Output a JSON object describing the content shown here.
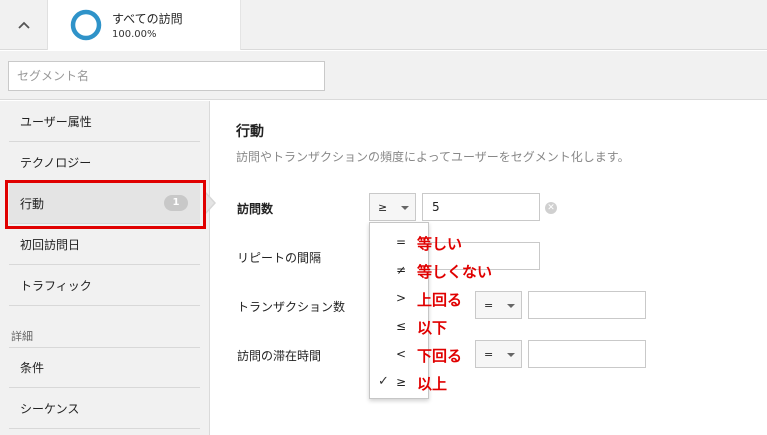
{
  "header": {
    "segment": {
      "name": "すべての訪問",
      "percentage": "100.00%",
      "ring_color": "#2f93c9"
    },
    "collapse_icon": "chevron-up-icon"
  },
  "search": {
    "placeholder": "セグメント名"
  },
  "sidebar": {
    "items": [
      {
        "label": "ユーザー属性"
      },
      {
        "label": "テクノロジー"
      },
      {
        "label": "行動",
        "badge": "1",
        "active": true
      },
      {
        "label": "初回訪問日"
      },
      {
        "label": "トラフィック"
      }
    ],
    "section_label": "詳細",
    "advanced_items": [
      {
        "label": "条件"
      },
      {
        "label": "シーケンス"
      }
    ],
    "highlight_color": "#e00000"
  },
  "main": {
    "title": "行動",
    "description": "訪問やトランザクションの頻度によってユーザーをセグメント化します。",
    "rows": [
      {
        "label": "訪問数",
        "operator": "≥",
        "value": "5"
      },
      {
        "label": "リピートの間隔"
      },
      {
        "label": "トランザクション数",
        "operator": "="
      },
      {
        "label": "訪問の滞在時間",
        "operator": "="
      }
    ]
  },
  "dropdown": {
    "options": [
      {
        "symbol": "=",
        "note": "等しい",
        "selected": false
      },
      {
        "symbol": "≠",
        "note": "等しくない",
        "selected": false
      },
      {
        "symbol": ">",
        "note": "上回る",
        "selected": false
      },
      {
        "symbol": "≤",
        "note": "以下",
        "selected": false
      },
      {
        "symbol": "<",
        "note": "下回る",
        "selected": false
      },
      {
        "symbol": "≥",
        "note": "以上",
        "selected": true
      }
    ],
    "check_icon": "checkmark-icon"
  },
  "colors": {
    "annotation": "#e00000",
    "panel_bg": "#f1f1f1"
  }
}
